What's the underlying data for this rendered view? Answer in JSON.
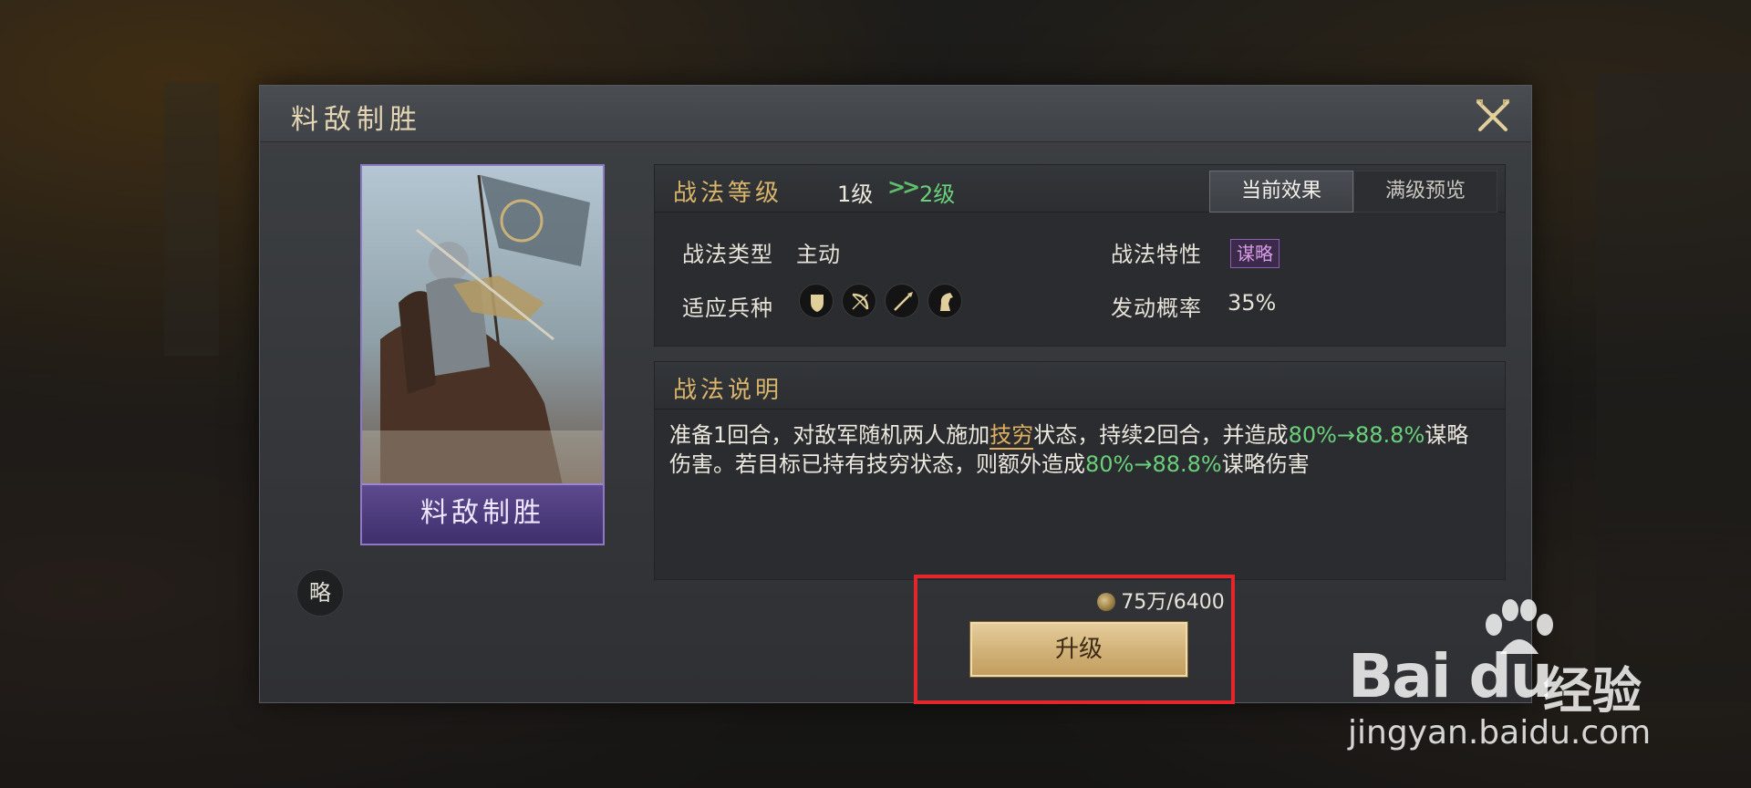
{
  "dialog": {
    "title": "料敌制胜",
    "close_icon": "close-swords-icon"
  },
  "card": {
    "name": "料敌制胜",
    "type_badge": "略"
  },
  "level": {
    "label": "战法等级",
    "current": "1级",
    "arrow": ">>",
    "next": "2级"
  },
  "tabs": [
    {
      "label": "当前效果",
      "active": true
    },
    {
      "label": "满级预览",
      "active": false
    }
  ],
  "attributes": {
    "type_label": "战法类型",
    "type_value": "主动",
    "trait_label": "战法特性",
    "trait_value": "谋略",
    "units_label": "适应兵种",
    "units_icons": [
      "shield-icon",
      "bow-icon",
      "spear-icon",
      "horse-icon"
    ],
    "rate_label": "发动概率",
    "rate_value": "35%"
  },
  "description": {
    "title": "战法说明",
    "p1": "准备1回合，对敌军随机两人施加",
    "status": "技穷",
    "p2": "状态，持续2回合，并造成",
    "dmg1": "80%→88.8%",
    "p3": "谋略伤害。若目标已持有技穷状态，则额外造成",
    "dmg2": "80%→88.8%",
    "p4": "谋略伤害"
  },
  "cost": {
    "icon": "copper-coin-icon",
    "text": "75万/6400"
  },
  "upgrade_button": "升级",
  "watermark": {
    "brand": "Bai du",
    "product": "经验",
    "url": "jingyan.baidu.com"
  },
  "colors": {
    "gold": "#d9b46b",
    "green": "#6ad07a",
    "card_purple": "#5d4a8f",
    "highlight_red": "#e2262b"
  }
}
